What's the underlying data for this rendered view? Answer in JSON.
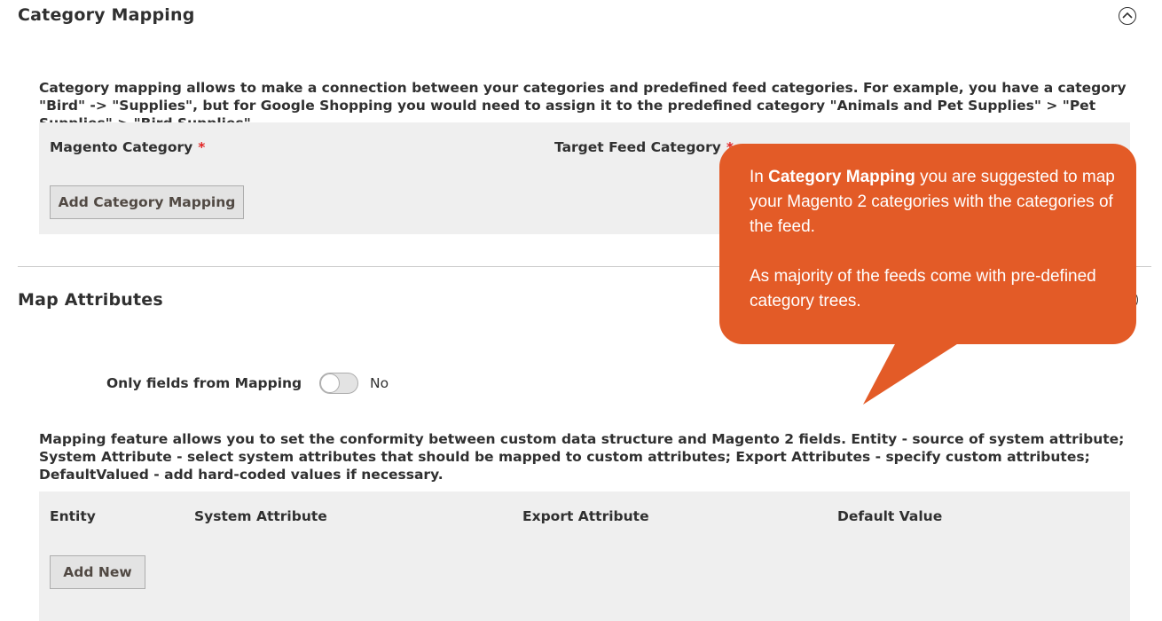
{
  "category_mapping": {
    "title": "Category Mapping",
    "description": "Category mapping allows to make a connection between your categories and predefined feed categories. For example, you have a category \"Bird\" -> \"Supplies\", but for Google Shopping you would need to assign it to the predefined category \"Animals and Pet Supplies\" > \"Pet Supplies\" > \"Bird Supplies\".",
    "columns": [
      {
        "label": "Magento Category",
        "required_mark": "*"
      },
      {
        "label": "Target Feed Category",
        "required_mark": "*"
      }
    ],
    "add_button_label": "Add Category Mapping"
  },
  "map_attributes": {
    "title": "Map Attributes",
    "toggle": {
      "label": "Only fields from Mapping",
      "value": "No",
      "checked": false
    },
    "description": "Mapping feature allows you to set the conformity between custom data structure and Magento 2 fields. Entity - source of system attribute; System Attribute - select system attributes that should be mapped to custom attributes; Export Attributes - specify custom attributes; DefaultValued - add hard-coded values if necessary.",
    "columns": [
      "Entity",
      "System Attribute",
      "Export Attribute",
      "Default Value"
    ],
    "add_button_label": "Add New"
  },
  "tooltip": {
    "line1_prefix": "In ",
    "line1_bold": "Category Mapping",
    "line1_suffix": " you are suggested to map your Magento 2 categories with the categories of the feed.",
    "paragraph2": "As majority of the feeds come with pre-defined category trees.",
    "background_color": "#e35b27"
  },
  "icons": {
    "collapse": "chevron-up-circle-icon"
  },
  "colors": {
    "required": "#e22626",
    "panel_bg": "#efefef"
  }
}
